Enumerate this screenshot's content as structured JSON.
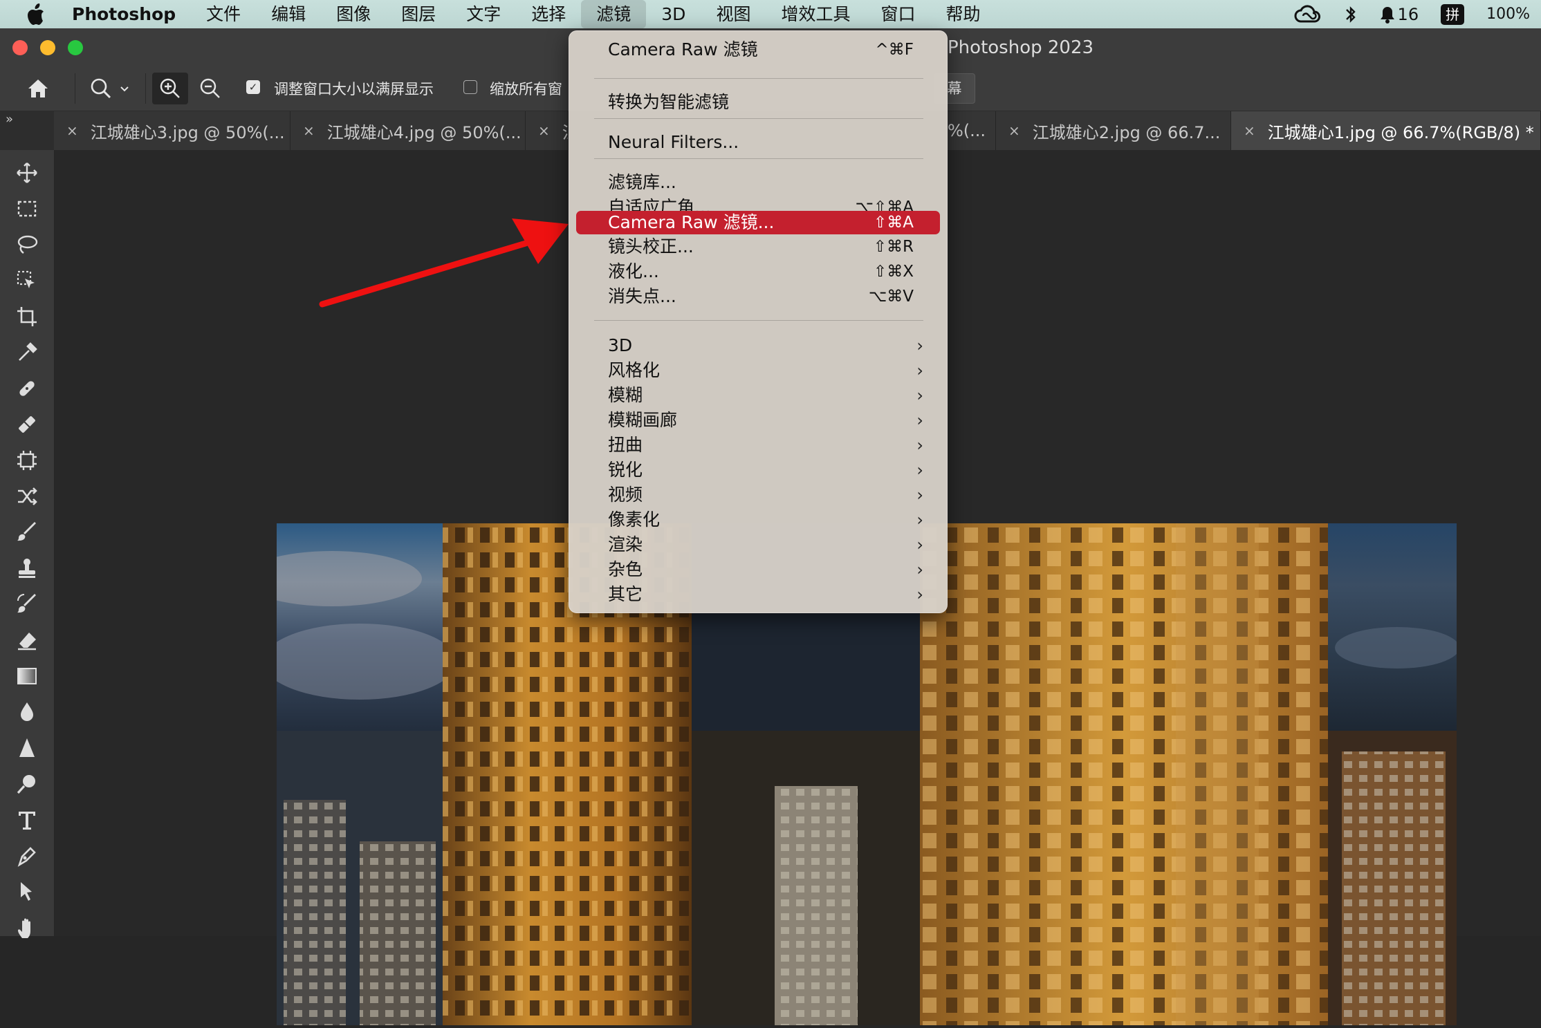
{
  "menubar": {
    "app_name": "Photoshop",
    "menus": [
      "文件",
      "编辑",
      "图像",
      "图层",
      "文字",
      "选择",
      "滤镜",
      "3D",
      "视图",
      "增效工具",
      "窗口",
      "帮助"
    ],
    "active_menu": "滤镜",
    "status": {
      "notifications": "16",
      "input_method": "拼",
      "battery": "100%"
    }
  },
  "window": {
    "title": "Photoshop 2023"
  },
  "options_bar": {
    "resize_windows_label": "调整窗口大小以满屏显示",
    "resize_windows_checked": true,
    "zoom_all_label": "缩放所有窗",
    "zoom_all_checked": false,
    "fill_screen_label": "幕"
  },
  "tabs": [
    {
      "label": "江城雄心3.jpg @ 50%(...",
      "active": false
    },
    {
      "label": "江城雄心4.jpg @ 50%(...",
      "active": false
    },
    {
      "label": "江",
      "active": false
    },
    {
      "label": "%(...",
      "active": false
    },
    {
      "label": "江城雄心2.jpg @ 66.7...",
      "active": false
    },
    {
      "label": "江城雄心1.jpg @ 66.7%(RGB/8) *",
      "active": true
    }
  ],
  "tab_close_glyph": "×",
  "collapse_glyph": "»",
  "filter_menu": {
    "items": [
      {
        "label": "Camera Raw 滤镜",
        "shortcut": "^⌘F"
      },
      {
        "label": "转换为智能滤镜",
        "shortcut": ""
      },
      {
        "label": "Neural Filters...",
        "shortcut": ""
      },
      {
        "label": "滤镜库...",
        "shortcut": ""
      },
      {
        "label": "自适应广角...",
        "shortcut": "⌥⇧⌘A"
      },
      {
        "label": "Camera Raw 滤镜...",
        "shortcut": "⇧⌘A",
        "highlighted": true
      },
      {
        "label": "镜头校正...",
        "shortcut": "⇧⌘R"
      },
      {
        "label": "液化...",
        "shortcut": "⇧⌘X"
      },
      {
        "label": "消失点...",
        "shortcut": "⌥⌘V"
      }
    ],
    "submenus": [
      "3D",
      "风格化",
      "模糊",
      "模糊画廊",
      "扭曲",
      "锐化",
      "视频",
      "像素化",
      "渲染",
      "杂色",
      "其它"
    ],
    "submenu_arrow": "›"
  },
  "tools": [
    "move-tool",
    "marquee-tool",
    "lasso-tool",
    "object-selection-tool",
    "crop-tool",
    "eyedropper-tool",
    "healing-brush-tool",
    "patch-tool",
    "frame-tool",
    "content-aware-move-tool",
    "brush-tool",
    "stamp-tool",
    "history-brush-tool",
    "eraser-tool",
    "gradient-tool",
    "blur-tool",
    "sharpen-tool",
    "dodge-tool",
    "type-tool",
    "pen-tool",
    "path-selection-tool",
    "hand-tool"
  ],
  "colors": {
    "highlight": "#c4202e",
    "arrow": "#ee1111"
  }
}
